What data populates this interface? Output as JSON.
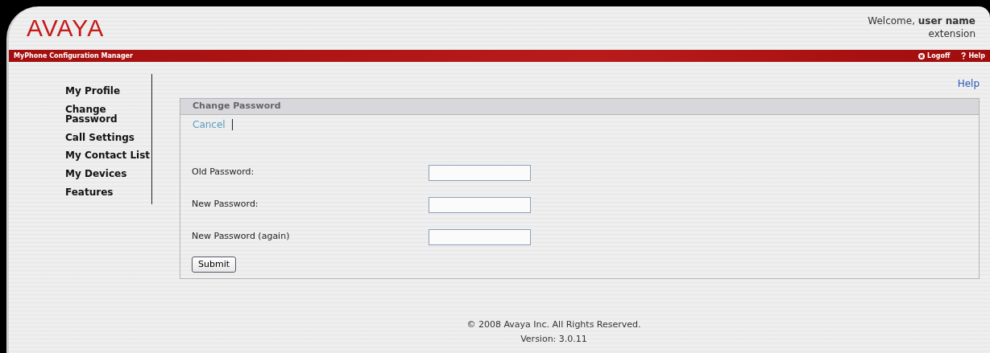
{
  "header": {
    "logo": "AVAYA",
    "welcome": "Welcome, **user name**",
    "extension": "extension"
  },
  "red_bar": {
    "title": "MyPhone Configuration Manager",
    "links": [
      {
        "label": "Logoff"
      },
      {
        "label": "Help"
      }
    ]
  },
  "sidebar": {
    "items": [
      {
        "label": "My Profile"
      },
      {
        "label": "Change Password"
      },
      {
        "label": "Call Settings"
      },
      {
        "label": "My Contact List"
      },
      {
        "label": "My Devices"
      },
      {
        "label": "Features"
      }
    ]
  },
  "help_link": "Help",
  "panel": {
    "title": "Change Password",
    "actions": [
      "Cancel"
    ],
    "fields": [
      {
        "label": "Old Password:"
      },
      {
        "label": "New Password:"
      },
      {
        "label": "New Password (again)"
      }
    ],
    "submit": "Submit"
  },
  "footer": [
    "© 2008 Avaya Inc. All Rights Reserved.",
    "Version: 3.0.11"
  ]
}
